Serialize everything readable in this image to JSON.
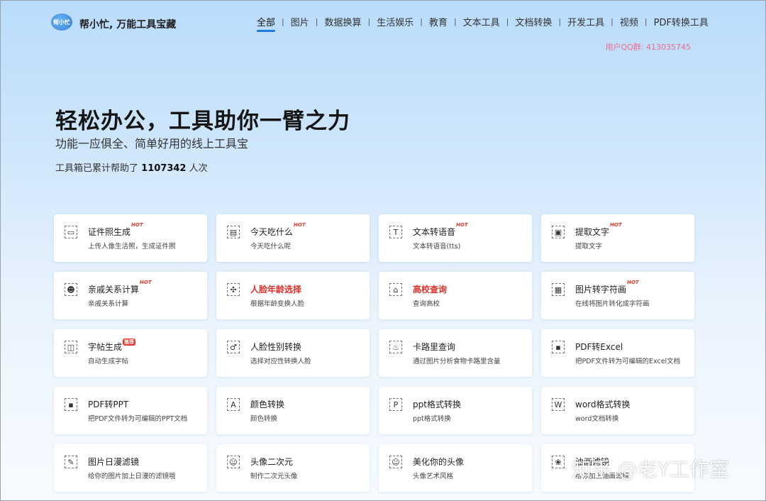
{
  "header": {
    "logo_text": "帮小忙",
    "brand": "帮小忙, 万能工具宝藏",
    "nav": [
      "全部",
      "图片",
      "数据换算",
      "生活娱乐",
      "教育",
      "文本工具",
      "文档转换",
      "开发工具",
      "视频",
      "PDF转换工具"
    ],
    "active_nav": "全部",
    "qq_group": "用户QQ群: 413035745"
  },
  "hero": {
    "title": "轻松办公，工具助你一臂之力",
    "subtitle": "功能一应俱全、简单好用的线上工具宝",
    "count_prefix": "工具箱已累计帮助了",
    "count_value": "1107342",
    "count_suffix": "人次"
  },
  "tools": [
    {
      "title": "证件照生成",
      "desc": "上传人像生活照，生成证件照",
      "badge": "HOT",
      "icon": "id-card-icon",
      "glyph": "▭"
    },
    {
      "title": "今天吃什么",
      "desc": "今天吃什么呢",
      "badge": "HOT",
      "icon": "food-box-icon",
      "glyph": "▤"
    },
    {
      "title": "文本转语音",
      "desc": "文本转语音(tts)",
      "badge": "HOT",
      "icon": "text-to-speech-icon",
      "glyph": "T"
    },
    {
      "title": "提取文字",
      "desc": "提取文字",
      "badge": "HOT",
      "icon": "ocr-icon",
      "glyph": "▣"
    },
    {
      "title": "亲戚关系计算",
      "desc": "亲戚关系计算",
      "badge": "HOT",
      "icon": "family-icon",
      "glyph": "☻"
    },
    {
      "title": "人脸年龄选择",
      "desc": "根据年龄变换人脸",
      "badge": "",
      "icon": "face-grid-icon",
      "glyph": "✣",
      "red": true
    },
    {
      "title": "高校查询",
      "desc": "查询高校",
      "badge": "",
      "icon": "school-icon",
      "glyph": "⌂",
      "red": true
    },
    {
      "title": "图片转字符画",
      "desc": "在线将图片转化成字符画",
      "badge": "HOT",
      "icon": "image-to-text-icon",
      "glyph": "▦"
    },
    {
      "title": "字帖生成",
      "desc": "自动生成字帖",
      "badge": "推荐",
      "icon": "copybook-icon",
      "glyph": "◫"
    },
    {
      "title": "人脸性别转换",
      "desc": "选择对应性转换人脸",
      "badge": "",
      "icon": "gender-icon",
      "glyph": "♂"
    },
    {
      "title": "卡路里查询",
      "desc": "通过图片分析食物卡路里含量",
      "badge": "",
      "icon": "calorie-icon",
      "glyph": "♨"
    },
    {
      "title": "PDF转Excel",
      "desc": "把PDF文件转为可编辑的Excel文档",
      "badge": "",
      "icon": "pdf-excel-icon",
      "glyph": "▪"
    },
    {
      "title": "PDF转PPT",
      "desc": "把PDF文件转为可编辑的PPT文档",
      "badge": "",
      "icon": "pdf-ppt-icon",
      "glyph": "▪"
    },
    {
      "title": "颜色转换",
      "desc": "颜色转换",
      "badge": "",
      "icon": "color-icon",
      "glyph": "A"
    },
    {
      "title": "ppt格式转换",
      "desc": "ppt格式转换",
      "badge": "",
      "icon": "ppt-icon",
      "glyph": "P"
    },
    {
      "title": "word格式转换",
      "desc": "word文档转换",
      "badge": "",
      "icon": "word-icon",
      "glyph": "W"
    },
    {
      "title": "图片日漫滤镜",
      "desc": "给你的图片加上日漫的滤镜哦",
      "badge": "",
      "icon": "anime-filter-icon",
      "glyph": "✎"
    },
    {
      "title": "头像二次元",
      "desc": "制作二次元头像",
      "badge": "",
      "icon": "anime-avatar-icon",
      "glyph": "☺"
    },
    {
      "title": "美化你的头像",
      "desc": "头像艺术风格",
      "badge": "",
      "icon": "beautify-avatar-icon",
      "glyph": "☺"
    },
    {
      "title": "油画滤镜",
      "desc": "给你加上油画滤镜",
      "badge": "",
      "icon": "oil-painting-icon",
      "glyph": "❀"
    }
  ],
  "watermark": "知乎 @老Y工作室",
  "colors": {
    "accent": "#1e7be0",
    "hot": "#e53a2c",
    "qq": "#f06a8a"
  }
}
